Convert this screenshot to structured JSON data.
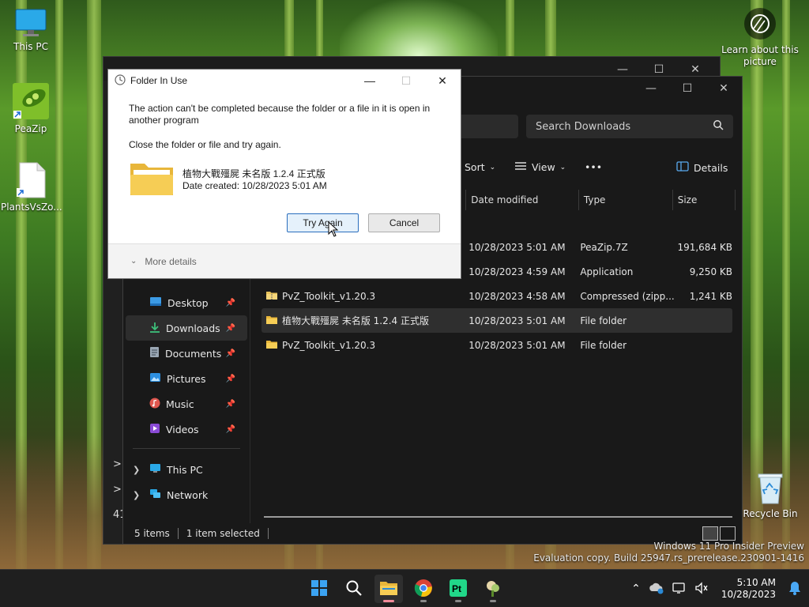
{
  "desktop": {
    "icons": [
      {
        "label": "This PC"
      },
      {
        "label": "PeaZip"
      },
      {
        "label": "PlantsVsZo..."
      }
    ],
    "learn_about": "Learn about this picture",
    "recycle_bin": "Recycle Bin",
    "watermark_line1": "Windows 11 Pro Insider Preview",
    "watermark_line2": "Evaluation copy. Build 25947.rs_prerelease.230901-1416"
  },
  "back_window": {
    "left_numbers": [
      ">",
      ">",
      "41"
    ]
  },
  "explorer": {
    "search_placeholder": "Search Downloads",
    "toolbar": {
      "sort": "Sort",
      "view": "View",
      "more": "•••",
      "details": "Details"
    },
    "columns": {
      "date": "Date modified",
      "type": "Type",
      "size": "Size"
    },
    "rows": [
      {
        "name": "",
        "date": "10/28/2023 5:01 AM",
        "type": "PeaZip.7Z",
        "size": "191,684 KB",
        "icon": "none"
      },
      {
        "name": "",
        "date": "10/28/2023 4:59 AM",
        "type": "Application",
        "size": "9,250 KB",
        "icon": "none"
      },
      {
        "name": "PvZ_Toolkit_v1.20.3",
        "date": "10/28/2023 4:58 AM",
        "type": "Compressed (zipp...",
        "size": "1,241 KB",
        "icon": "zip-folder-icon"
      },
      {
        "name": "植物大戰殭屍 未名版 1.2.4 正式版",
        "date": "10/28/2023 5:01 AM",
        "type": "File folder",
        "size": "",
        "icon": "folder-icon"
      },
      {
        "name": "PvZ_Toolkit_v1.20.3",
        "date": "10/28/2023 5:01 AM",
        "type": "File folder",
        "size": "",
        "icon": "folder-icon"
      }
    ],
    "nav": {
      "desktop": "Desktop",
      "downloads": "Downloads",
      "documents": "Documents",
      "pictures": "Pictures",
      "music": "Music",
      "videos": "Videos",
      "this_pc": "This PC",
      "network": "Network"
    },
    "status": {
      "items": "5 items",
      "selected": "1 item selected"
    }
  },
  "dialog": {
    "title": "Folder In Use",
    "message": "The action can't be completed because the folder or a file in it is open in another program",
    "instruction": "Close the folder or file and try again.",
    "file_name": "植物大戰殭屍 未名版 1.2.4 正式版",
    "file_date": "Date created: 10/28/2023 5:01 AM",
    "try_again": "Try Again",
    "cancel": "Cancel",
    "more_details": "More details"
  },
  "taskbar": {
    "time": "5:10 AM",
    "date": "10/28/2023"
  },
  "colors": {
    "accent": "#0078d4",
    "dialog_primary_border": "#2a6ebd"
  }
}
